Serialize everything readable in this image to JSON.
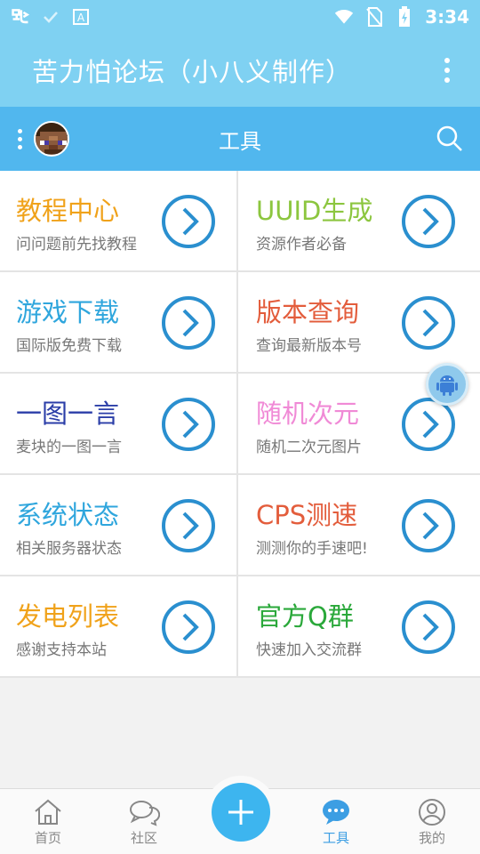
{
  "status_bar": {
    "time": "3:34",
    "left_icons": [
      "app-logo-icon",
      "check-icon",
      "font-icon"
    ],
    "right_icons": [
      "wifi-icon",
      "no-sim-icon",
      "battery-icon"
    ]
  },
  "app_bar": {
    "title": "苦力怕论坛（小八义制作）",
    "menu_icon": "more-vert-icon"
  },
  "sub_bar": {
    "title": "工具",
    "menu_icon": "more-vert-icon",
    "avatar_icon": "avatar",
    "search_icon": "search-icon"
  },
  "colors": {
    "status_bar_bg": "#7fd1f2",
    "app_bar_bg": "#7fd1f2",
    "sub_bar_bg": "#51b7ee",
    "accent": "#2a8fcf",
    "active_nav": "#3c9ee3",
    "plus_button": "#3db5ef"
  },
  "tools": [
    {
      "title": "教程中心",
      "subtitle": "问问题前先找教程",
      "color": "#f0a21a"
    },
    {
      "title": "UUID生成",
      "subtitle": "资源作者必备",
      "color": "#8cc63f"
    },
    {
      "title": "游戏下载",
      "subtitle": "国际版免费下载",
      "color": "#2fa6dd"
    },
    {
      "title": "版本查询",
      "subtitle": "查询最新版本号",
      "color": "#e35d3c"
    },
    {
      "title": "一图一言",
      "subtitle": "麦块的一图一言",
      "color": "#2b3ea8"
    },
    {
      "title": "随机次元",
      "subtitle": "随机二次元图片",
      "color": "#f08ad6"
    },
    {
      "title": "系统状态",
      "subtitle": "相关服务器状态",
      "color": "#2fa6dd"
    },
    {
      "title": "CPS测速",
      "subtitle": "测测你的手速吧!",
      "color": "#e35d3c"
    },
    {
      "title": "发电列表",
      "subtitle": "感谢支持本站",
      "color": "#f0a21a"
    },
    {
      "title": "官方Q群",
      "subtitle": "快速加入交流群",
      "color": "#2aa83a"
    }
  ],
  "arrow_icon": "chevron-right-circle-icon",
  "float_button_icon": "android-icon",
  "bottom_nav": {
    "items": [
      {
        "label": "首页",
        "icon": "home-icon",
        "active": false
      },
      {
        "label": "社区",
        "icon": "chat-icon",
        "active": false
      },
      {
        "label": "工具",
        "icon": "more-chat-icon",
        "active": true
      },
      {
        "label": "我的",
        "icon": "user-icon",
        "active": false
      }
    ],
    "center_icon": "plus-icon"
  }
}
